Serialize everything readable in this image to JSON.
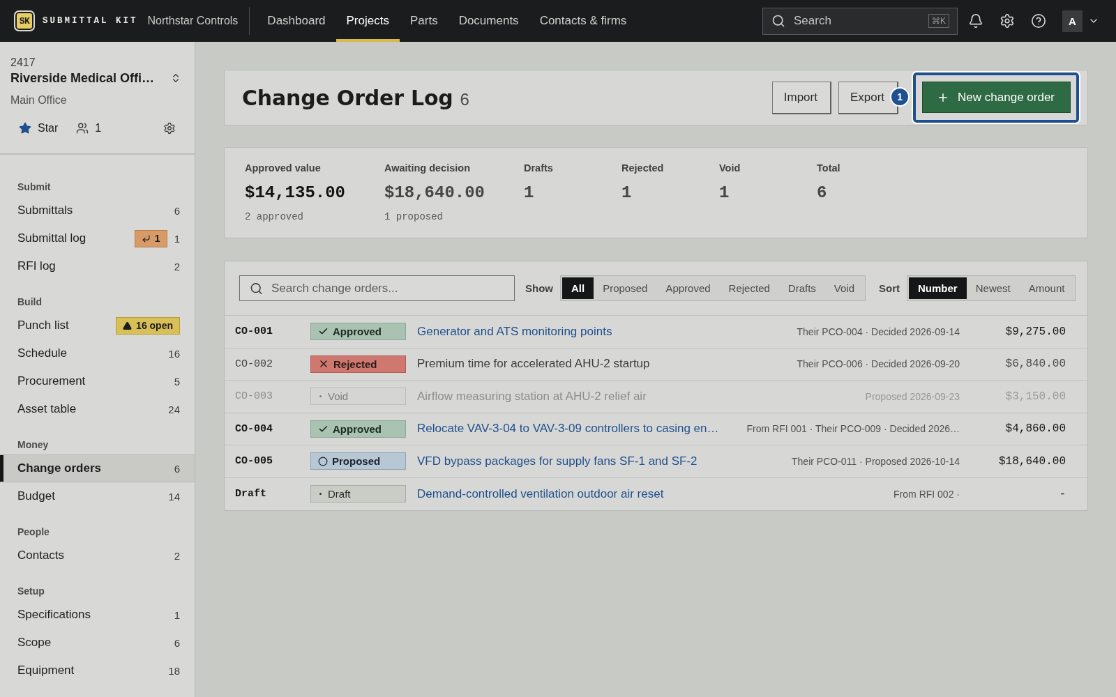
{
  "top_bar": {
    "logo": {
      "mark": "SK",
      "wordmark": "SUBMITTAL KIT"
    },
    "company": "Northstar Controls",
    "nav": [
      {
        "label": "Dashboard",
        "selected": false
      },
      {
        "label": "Projects",
        "selected": true
      },
      {
        "label": "Parts",
        "selected": false
      },
      {
        "label": "Documents",
        "selected": false
      },
      {
        "label": "Contacts & firms",
        "selected": false
      }
    ],
    "search": {
      "placeholder": "Search",
      "shortcut": "⌘K"
    },
    "avatar": "A"
  },
  "sidebar": {
    "project": {
      "number": "2417",
      "name": "Riverside Medical Offi…",
      "office": "Main Office",
      "star": {
        "label": "Star",
        "starred": true
      },
      "members": "1"
    },
    "sections": [
      {
        "title": "Submit",
        "items": [
          {
            "label": "Submittals",
            "count": "6",
            "selected": false
          },
          {
            "label": "Submittal log",
            "badge": {
              "kind": "returned",
              "text": "1"
            },
            "count": "1",
            "selected": false
          },
          {
            "label": "RFI log",
            "count": "2",
            "selected": false
          }
        ]
      },
      {
        "title": "Build",
        "items": [
          {
            "label": "Punch list",
            "badge": {
              "kind": "warning",
              "text": "16 open"
            },
            "selected": false
          },
          {
            "label": "Schedule",
            "count": "16",
            "selected": false
          },
          {
            "label": "Procurement",
            "count": "5",
            "selected": false
          },
          {
            "label": "Asset table",
            "count": "24",
            "selected": false
          }
        ]
      },
      {
        "title": "Money",
        "items": [
          {
            "label": "Change orders",
            "count": "6",
            "selected": true
          },
          {
            "label": "Budget",
            "count": "14",
            "selected": false
          }
        ]
      },
      {
        "title": "People",
        "items": [
          {
            "label": "Contacts",
            "count": "2",
            "selected": false
          }
        ]
      },
      {
        "title": "Setup",
        "items": [
          {
            "label": "Specifications",
            "count": "1",
            "selected": false
          },
          {
            "label": "Scope",
            "count": "6",
            "selected": false
          },
          {
            "label": "Equipment",
            "count": "18",
            "selected": false
          }
        ]
      }
    ]
  },
  "page_header": {
    "title": "Change Order Log",
    "count": "6",
    "buttons": [
      {
        "label": "Import",
        "kind": "secondary",
        "highlighted": false
      },
      {
        "label": "Export",
        "kind": "secondary",
        "highlighted": false
      },
      {
        "label": "New change order",
        "kind": "primary",
        "highlighted": true
      }
    ],
    "highlight_marker": "1"
  },
  "stats": [
    {
      "label": "Approved value",
      "value": "$14,135.00",
      "note": "2 approved",
      "emphasis": true
    },
    {
      "label": "Awaiting decision",
      "value": "$18,640.00",
      "note": "1 proposed",
      "emphasis": false
    },
    {
      "label": "Drafts",
      "value": "1",
      "emphasis": false
    },
    {
      "label": "Rejected",
      "value": "1",
      "emphasis": false
    },
    {
      "label": "Void",
      "value": "1",
      "emphasis": false
    },
    {
      "label": "Total",
      "value": "6",
      "emphasis": false
    }
  ],
  "change_orders": {
    "search": {
      "placeholder": "Search change orders..."
    },
    "show": {
      "label": "Show",
      "options": [
        {
          "label": "All",
          "selected": true
        },
        {
          "label": "Proposed",
          "selected": false
        },
        {
          "label": "Approved",
          "selected": false
        },
        {
          "label": "Rejected",
          "selected": false
        },
        {
          "label": "Drafts",
          "selected": false
        },
        {
          "label": "Void",
          "selected": false
        }
      ]
    },
    "sort": {
      "label": "Sort",
      "options": [
        {
          "label": "Number",
          "selected": true
        },
        {
          "label": "Newest",
          "selected": false
        },
        {
          "label": "Amount",
          "selected": false
        }
      ]
    },
    "rows": [
      {
        "number": "CO-001",
        "status": {
          "kind": "approved",
          "label": "Approved"
        },
        "title": "Generator and ATS monitoring points",
        "meta": "Their PCO-004 · Decided 2026-09-14",
        "amount": "$9,275.00"
      },
      {
        "number": "CO-002",
        "status": {
          "kind": "rejected",
          "label": "Rejected"
        },
        "title": "Premium time for accelerated AHU-2 startup",
        "meta": "Their PCO-006 · Decided 2026-09-20",
        "amount": "$6,840.00"
      },
      {
        "number": "CO-003",
        "status": {
          "kind": "void",
          "label": "Void"
        },
        "title": "Airflow measuring station at AHU-2 relief air",
        "meta": "Proposed 2026-09-23",
        "amount": "$3,150.00"
      },
      {
        "number": "CO-004",
        "status": {
          "kind": "approved",
          "label": "Approved"
        },
        "title": "Relocate VAV-3-04 to VAV-3-09 controllers to casing en…",
        "meta": "From RFI 001 · Their PCO-009 · Decided 2026…",
        "amount": "$4,860.00"
      },
      {
        "number": "CO-005",
        "status": {
          "kind": "proposed",
          "label": "Proposed"
        },
        "title": "VFD bypass packages for supply fans SF-1 and SF-2",
        "meta": "Their PCO-011 · Proposed 2026-10-14",
        "amount": "$18,640.00"
      },
      {
        "number": "Draft",
        "status": {
          "kind": "draft",
          "label": "Draft"
        },
        "title": "Demand-controlled ventilation outdoor air reset",
        "meta": "From RFI 002 ·",
        "amount": "-"
      }
    ]
  }
}
